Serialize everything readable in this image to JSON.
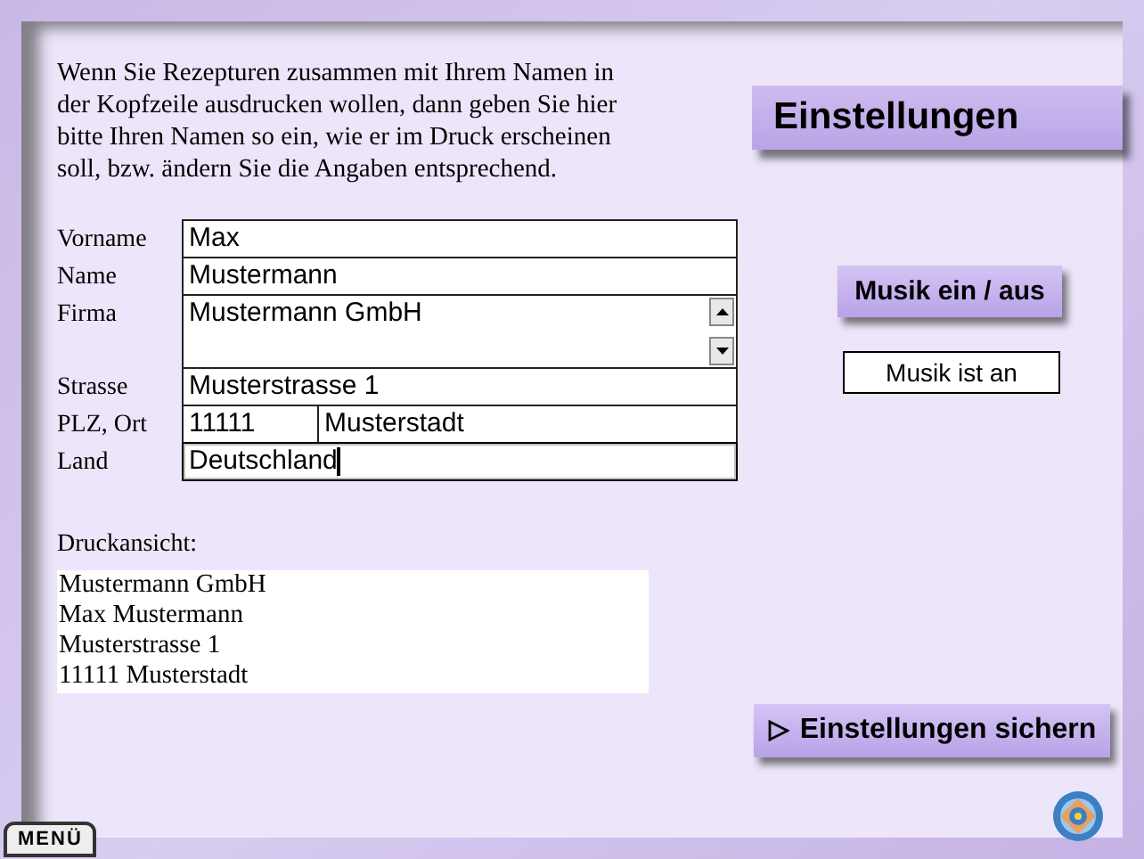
{
  "intro": "Wenn Sie Rezepturen zusammen mit Ihrem Namen in der Kopfzeile ausdrucken wollen, dann geben Sie hier bitte Ihren Namen so ein, wie er im Druck erscheinen soll, bzw. ändern Sie die Angaben entsprechend.",
  "title": "Einstellungen",
  "fields": [
    {
      "label": "Vorname",
      "kind": "text",
      "values": [
        "Max"
      ],
      "focused": false
    },
    {
      "label": "Name",
      "kind": "text",
      "values": [
        "Mustermann"
      ],
      "focused": false
    },
    {
      "label": "Firma",
      "kind": "multiline",
      "values": [
        "Mustermann GmbH"
      ],
      "focused": false
    },
    {
      "label": "Strasse",
      "kind": "text",
      "values": [
        "Musterstrasse 1"
      ],
      "focused": false
    },
    {
      "label": "PLZ, Ort",
      "kind": "split",
      "values": [
        "11111",
        "Musterstadt"
      ],
      "focused": false
    },
    {
      "label": "Land",
      "kind": "text",
      "values": [
        "Deutschland"
      ],
      "focused": true
    }
  ],
  "preview": {
    "label": "Druckansicht:",
    "lines": [
      "Mustermann GmbH",
      "Max Mustermann",
      "Musterstrasse 1",
      "11111 Musterstadt"
    ]
  },
  "music_button": "Musik ein / aus",
  "music_status": "Musik ist an",
  "save_button": "Einstellungen sichern",
  "menu_button": "MENÜ"
}
